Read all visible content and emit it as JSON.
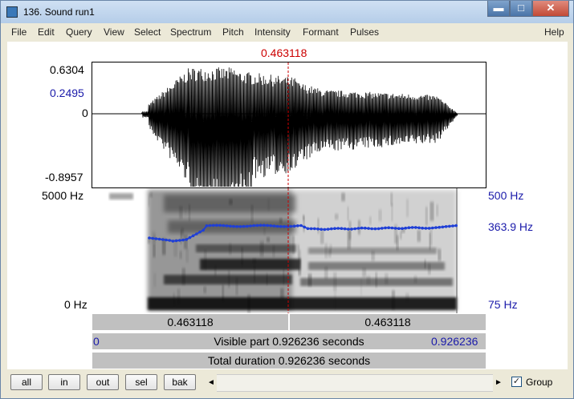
{
  "window": {
    "title": "136. Sound run1"
  },
  "menu": [
    "File",
    "Edit",
    "Query",
    "View",
    "Select",
    "Spectrum",
    "Pitch",
    "Intensity",
    "Formant",
    "Pulses",
    "Help"
  ],
  "cursor": {
    "time": "0.463118"
  },
  "waveform": {
    "max": "0.6304",
    "cursor_value": "0.2495",
    "zero": "0",
    "min": "-0.8957"
  },
  "spectrogram": {
    "freq_top": "5000 Hz",
    "freq_bottom": "0 Hz"
  },
  "pitch": {
    "top": "500 Hz",
    "current": "363.9 Hz",
    "bottom": "75 Hz",
    "color": "#1f3fd6"
  },
  "time_bars": {
    "left_segment": "0.463118",
    "right_segment": "0.463118",
    "visible_start": "0",
    "visible_text": "Visible part 0.926236 seconds",
    "visible_end": "0.926236",
    "total_text": "Total duration 0.926236 seconds"
  },
  "buttons": {
    "all": "all",
    "in": "in",
    "out": "out",
    "sel": "sel",
    "bak": "bak"
  },
  "scroll": {
    "left": "◄",
    "right": "►"
  },
  "group": {
    "label": "Group",
    "checked": true,
    "check_glyph": "✓"
  }
}
